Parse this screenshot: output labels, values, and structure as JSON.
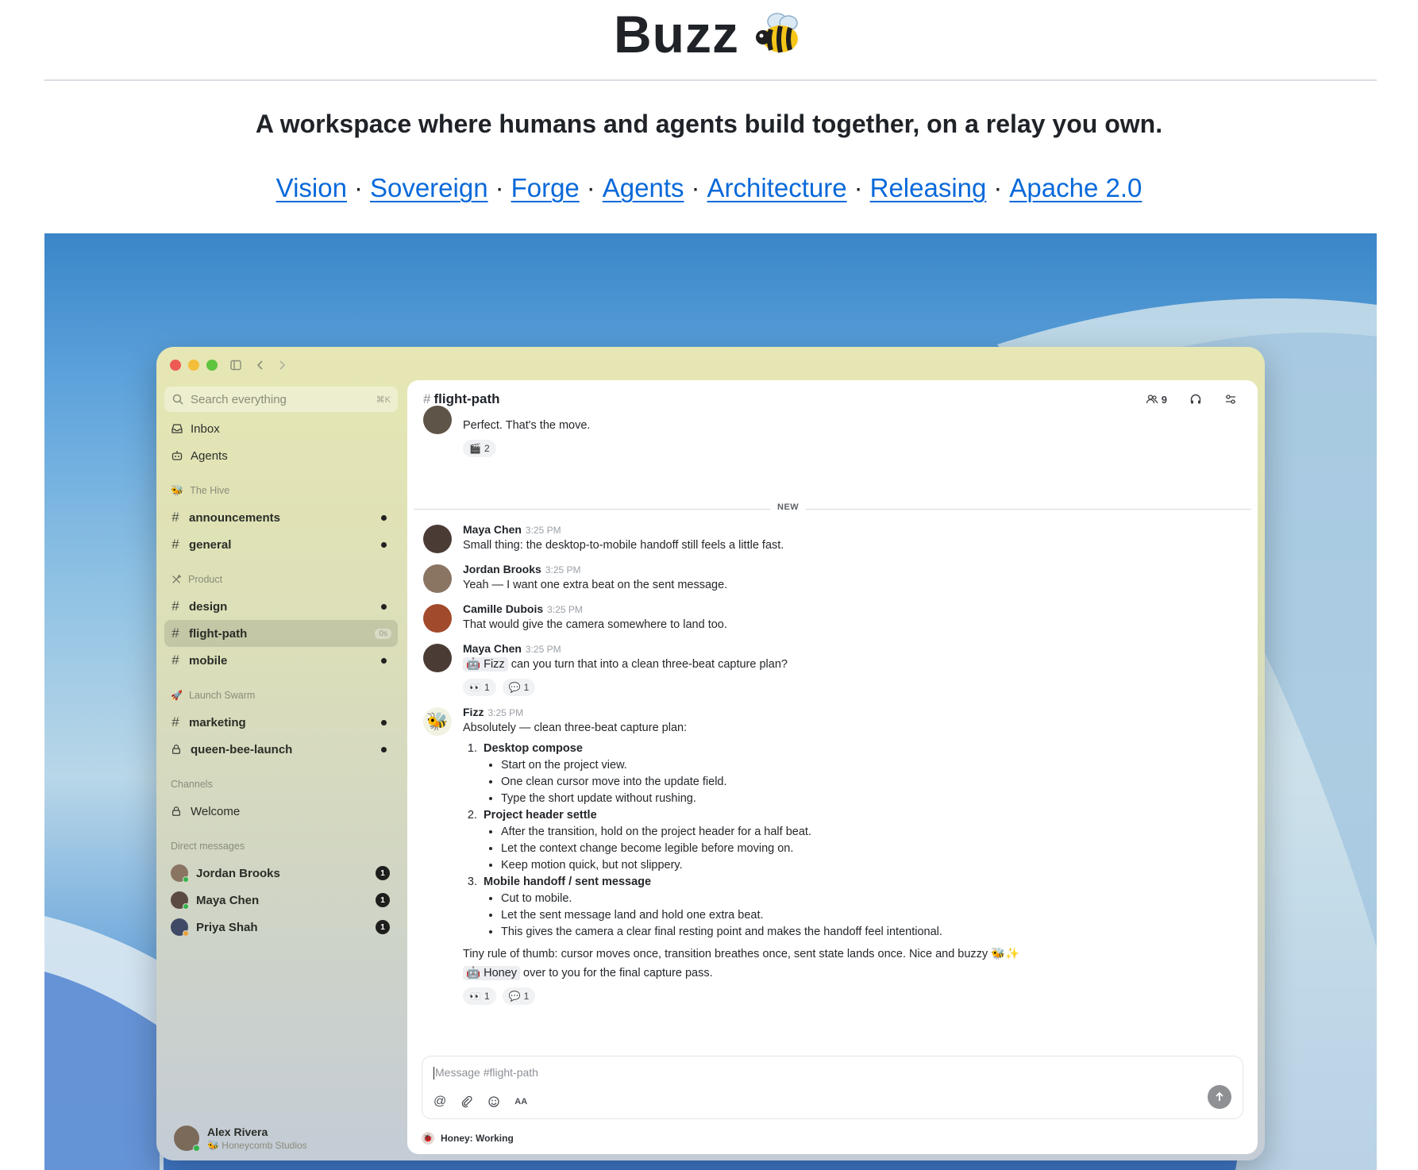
{
  "page": {
    "title": "Buzz",
    "tagline": "A workspace where humans and agents build together, on a relay you own.",
    "links": [
      "Vision",
      "Sovereign",
      "Forge",
      "Agents",
      "Architecture",
      "Releasing",
      "Apache 2.0"
    ],
    "separator": "·"
  },
  "app": {
    "search": {
      "placeholder": "Search everything",
      "shortcut": "⌘K"
    },
    "top_nav": [
      {
        "label": "Inbox",
        "icon": "inbox-icon"
      },
      {
        "label": "Agents",
        "icon": "robot-icon"
      }
    ],
    "sections": [
      {
        "title": "The Hive",
        "icon": "bee-icon",
        "channels": [
          {
            "name": "announcements",
            "kind": "hash",
            "unread": true
          },
          {
            "name": "general",
            "kind": "hash",
            "unread": true
          }
        ]
      },
      {
        "title": "Product",
        "icon": "tools-icon",
        "channels": [
          {
            "name": "design",
            "kind": "hash",
            "unread": true
          },
          {
            "name": "flight-path",
            "kind": "hash",
            "active": true,
            "time": "0s"
          },
          {
            "name": "mobile",
            "kind": "hash",
            "unread": true
          }
        ]
      },
      {
        "title": "Launch Swarm",
        "icon": "rocket-icon",
        "channels": [
          {
            "name": "marketing",
            "kind": "hash",
            "unread": true
          },
          {
            "name": "queen-bee-launch",
            "kind": "lock",
            "unread": true
          }
        ]
      },
      {
        "title": "Channels",
        "icon": "",
        "channels": [
          {
            "name": "Welcome",
            "kind": "lock",
            "unread": false
          }
        ]
      }
    ],
    "dms_title": "Direct messages",
    "dms": [
      {
        "name": "Jordan Brooks",
        "count": "1",
        "color": "#8a7462"
      },
      {
        "name": "Maya Chen",
        "count": "1",
        "color": "#5b4a42"
      },
      {
        "name": "Priya Shah",
        "count": "1",
        "color": "#3f4a66"
      }
    ],
    "me": {
      "name": "Alex Rivera",
      "org": "Honeycomb Studios"
    },
    "channel": {
      "name": "flight-path",
      "members": "9"
    },
    "messages": {
      "prev": {
        "text": "Perfect. That's the move.",
        "reaction": {
          "emoji": "🎬",
          "count": "2"
        }
      },
      "new_label": "NEW",
      "m1": {
        "author": "Maya Chen",
        "time": "3:25 PM",
        "text": "Small thing: the desktop-to-mobile handoff still feels a little fast."
      },
      "m2": {
        "author": "Jordan Brooks",
        "time": "3:25 PM",
        "text": "Yeah — I want one extra beat on the sent message."
      },
      "m3": {
        "author": "Camille Dubois",
        "time": "3:25 PM",
        "text": "That would give the camera somewhere to land too."
      },
      "m4": {
        "author": "Maya Chen",
        "time": "3:25 PM",
        "mention": "Fizz",
        "text": "can you turn that into a clean three-beat capture plan?",
        "reactions": [
          {
            "emoji": "👀",
            "count": "1"
          },
          {
            "emoji": "💬",
            "count": "1"
          }
        ]
      },
      "m5": {
        "author": "Fizz",
        "time": "3:25 PM",
        "intro": "Absolutely — clean three-beat capture plan:",
        "steps": [
          {
            "title": "Desktop compose",
            "items": [
              "Start on the project view.",
              "One clean cursor move into the update field.",
              "Type the short update without rushing."
            ]
          },
          {
            "title": "Project header settle",
            "items": [
              "After the transition, hold on the project header for a half beat.",
              "Let the context change become legible before moving on.",
              "Keep motion quick, but not slippery."
            ]
          },
          {
            "title": "Mobile handoff / sent message",
            "items": [
              "Cut to mobile.",
              "Let the sent message land and hold one extra beat.",
              "This gives the camera a clear final resting point and makes the handoff feel intentional."
            ]
          }
        ],
        "outro": "Tiny rule of thumb: cursor moves once, transition breathes once, sent state lands once. Nice and buzzy 🐝✨",
        "handoff_mention": "Honey",
        "handoff_text": "over to you for the final capture pass.",
        "reactions": [
          {
            "emoji": "👀",
            "count": "1"
          },
          {
            "emoji": "💬",
            "count": "1"
          }
        ]
      }
    },
    "composer": {
      "placeholder": "Message #flight-path",
      "format_label": "AA"
    },
    "status": "Honey: Working"
  }
}
